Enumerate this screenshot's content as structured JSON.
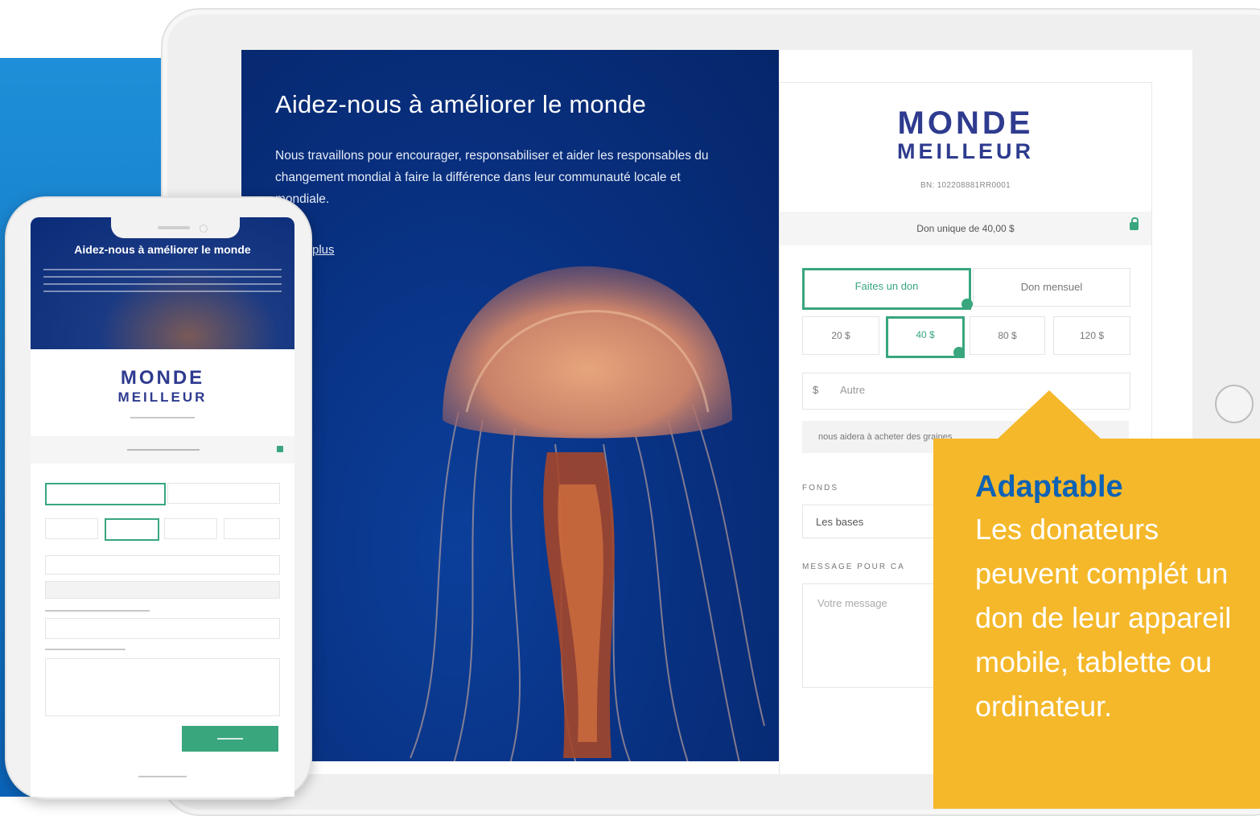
{
  "tablet": {
    "hero": {
      "title": "Aidez-nous à améliorer le monde",
      "text": "Nous travaillons pour encourager, responsabiliser et aider les responsables du changement mondial à faire la différence dans leur communauté locale et mondiale.",
      "more_link": "plus"
    },
    "form": {
      "logo_line1": "MONDE",
      "logo_line2": "MEILLEUR",
      "bn": "BN: 102208881RR0001",
      "summary": "Don unique de 40,00 $",
      "tabs": [
        "Faites un don",
        "Don mensuel"
      ],
      "amounts": [
        "20 $",
        "40 $",
        "80 $",
        "120 $"
      ],
      "selected_amount": "40 $",
      "currency_symbol": "$",
      "other_placeholder": "Autre",
      "impact_text": "nous aidera à acheter des graines",
      "fund_label": "FONDS",
      "fund_value": "Les bases",
      "message_label": "MESSAGE POUR CA",
      "message_placeholder": "Votre message"
    }
  },
  "phone": {
    "hero_title": "Aidez-nous à améliorer le monde",
    "logo_line1": "MONDE",
    "logo_line2": "MEILLEUR"
  },
  "callout": {
    "title": "Adaptable",
    "text": "Les donateurs peuvent complét un don de leur appareil mobile, tablette ou ordinateur."
  },
  "colors": {
    "brand_blue": "#2e3b8f",
    "accent_green": "#39a67d",
    "callout_yellow": "#f5b82a",
    "callout_title_blue": "#0e62b4"
  }
}
